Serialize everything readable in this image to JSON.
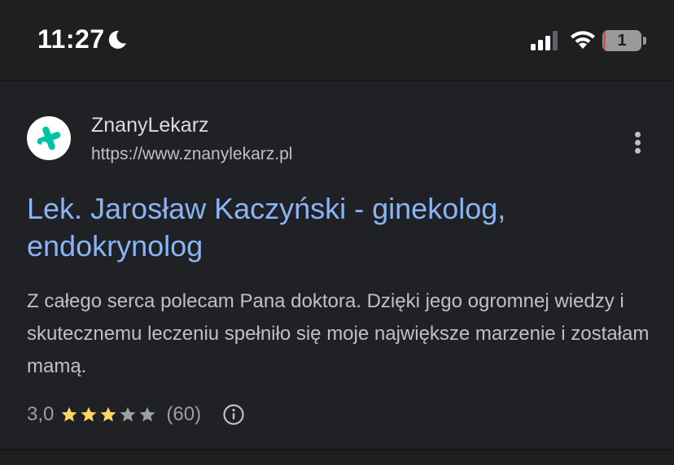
{
  "status_bar": {
    "time": "11:27",
    "battery_percent_label": "1",
    "icons": [
      "moon-icon",
      "signal-icon",
      "wifi-icon",
      "battery-icon"
    ],
    "battery_level": 0.05
  },
  "result": {
    "site_name": "ZnanyLekarz",
    "site_url": "https://www.znanylekarz.pl",
    "title": "Lek. Jarosław Kaczyński - ginekolog, endokrynolog",
    "snippet": "Z całego serca polecam Pana doktora. Dzięki jego ogromnej wiedzy i skutecznemu leczeniu spełniło się moje największe marzenie i zostałam mamą.",
    "rating": {
      "value_label": "3,0",
      "stars_filled": 3,
      "stars_total": 5,
      "count_label": "(60)"
    }
  },
  "colors": {
    "background": "#202124",
    "link": "#8ab4f8",
    "snippet": "#bdc1c6",
    "star_filled": "#fdd663",
    "star_empty": "#9aa0a6",
    "favicon_brand": "#00c3a5"
  }
}
